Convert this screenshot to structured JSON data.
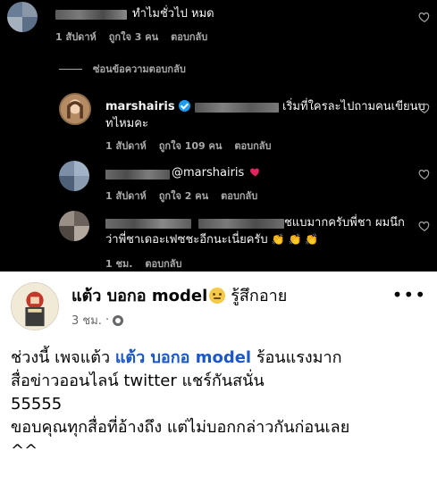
{
  "instagram": {
    "comments": [
      {
        "text": "ทำไมชั่วไป หมด",
        "time": "1 สัปดาห์",
        "likes": "ถูกใจ 3 คน",
        "reply": "ตอบกลับ"
      },
      {
        "hide_replies": "ซ่อนข้อความตอบกลับ"
      },
      {
        "username": "marshairis",
        "text_line1": "เริ่มที่ใครละไปถามคนเขียนบ",
        "text_line2": "ทไหมคะ",
        "time": "1 สัปดาห์",
        "likes": "ถูกใจ 109 คน",
        "reply": "ตอบกลับ"
      },
      {
        "mention": "@marshairis",
        "time": "1 สัปดาห์",
        "likes": "ถูกใจ 2 คน",
        "reply": "ตอบกลับ"
      },
      {
        "text_line1": "ชแบมากครับพี่ชา ผมนึก",
        "text_line2": "ว่าพี่ชาเดอะเฟซชะอีกนะเนี่ยครับ",
        "emojis": "👏 👏 👏",
        "time": "1 ชม.",
        "reply": "ตอบกลับ"
      }
    ],
    "heart_icon": "heart-outline-icon"
  },
  "facebook": {
    "author": "แต้ว บอกอ model",
    "feeling": "รู้สึกอาย",
    "time": "3 ชม.",
    "sep": "·",
    "more_icon": "•••",
    "body": {
      "line1_prefix": "ช่วงนี้ เพจแต้ว ",
      "line1_link": "แต้ว บอกอ model",
      "line1_suffix": " ร้อนแรงมาก",
      "line2": "สื่อข่าวออนไลน์ twitter แชร์กันสนั่น",
      "line3": "55555",
      "line4": "ขอบคุณทุกสื่อที่อ้างถึง แต่ไม่บอกกล่าวกันก่อนเลย",
      "line5": "^^"
    }
  },
  "colors": {
    "ig_bg": "#000000",
    "ig_meta": "#a8a8a8",
    "verified": "#1d9bf0",
    "heart_red": "#e0245e",
    "fb_link": "#1b57c9"
  }
}
